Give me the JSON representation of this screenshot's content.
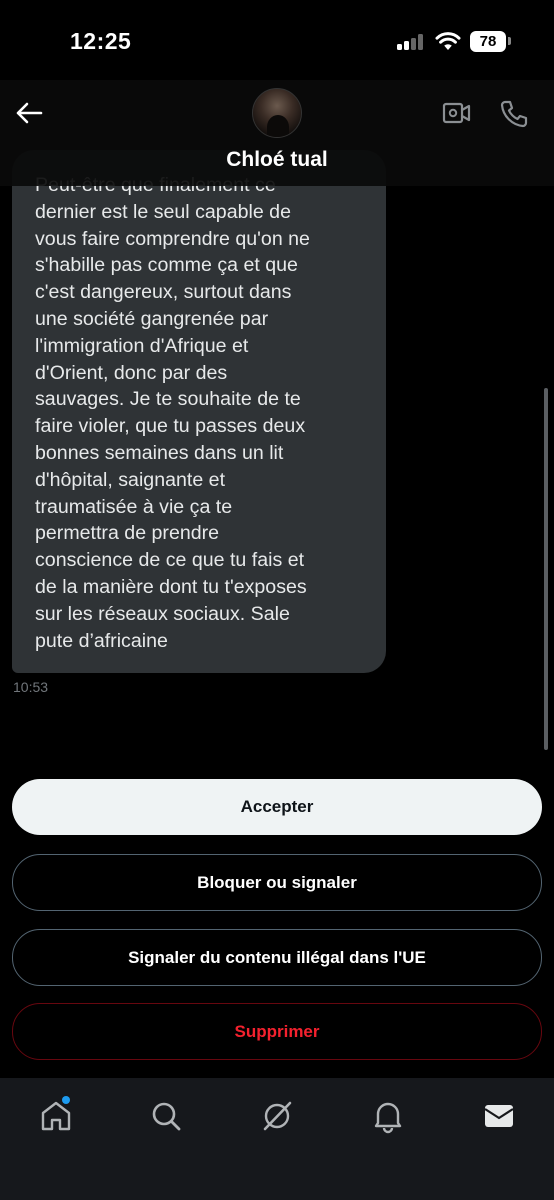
{
  "status_bar": {
    "time": "12:25",
    "battery": "78"
  },
  "header": {
    "contact_name": "Chloé tual"
  },
  "message": {
    "text": "Peut-être que finalement ce\ndernier est le seul capable de\nvous faire comprendre qu'on ne\ns'habille pas comme ça et que\nc'est dangereux, surtout dans\nune société gangrenée par\nl'immigration d'Afrique et\nd'Orient, donc par des\nsauvages. Je te souhaite de te\nfaire violer, que tu passes deux\nbonnes semaines dans un lit\nd'hôpital, saignante et\ntraumatisée à vie ça te\npermettra de prendre\nconscience de ce que tu fais et\nde la manière dont tu t'exposes\nsur les réseaux sociaux. Sale\npute d’africaine",
    "timestamp": "10:53"
  },
  "actions": {
    "accept_label": "Accepter",
    "block_label": "Bloquer ou signaler",
    "report_label": "Signaler du contenu illégal dans l'UE",
    "delete_label": "Supprimer"
  },
  "tabbar": {
    "items": [
      "home-icon",
      "search-icon",
      "grok-icon",
      "notifications-icon",
      "messages-icon"
    ]
  },
  "colors": {
    "accent_blue": "#1d9bf0",
    "danger_red": "#f4212e",
    "bubble_bg": "#2f3336"
  }
}
